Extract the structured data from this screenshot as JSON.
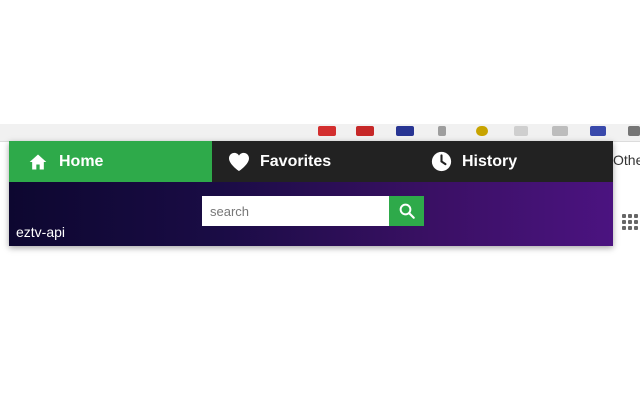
{
  "browser": {
    "bookmarks_overflow_label": "Othe"
  },
  "nav": {
    "tabs": [
      {
        "label": "Home",
        "icon": "home-icon",
        "active": true
      },
      {
        "label": "Favorites",
        "icon": "heart-icon",
        "active": false
      },
      {
        "label": "History",
        "icon": "clock-icon",
        "active": false
      }
    ]
  },
  "banner": {
    "app_name": "eztv-api"
  },
  "search": {
    "placeholder": "search",
    "value": "",
    "button_icon": "search-icon"
  },
  "colors": {
    "accent_green": "#2eaa4a",
    "nav_bg": "#222222",
    "banner_start": "#0d0730",
    "banner_end": "#4b1380"
  }
}
